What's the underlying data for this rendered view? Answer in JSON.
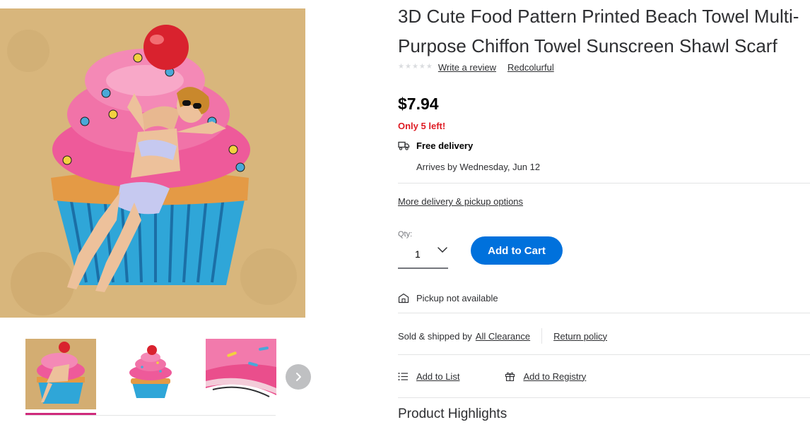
{
  "product": {
    "title_line1": "3D Cute Food Pattern Printed Beach Towel Multi-",
    "title_line2": "Purpose Chiffon Towel Sunscreen Shawl Scarf",
    "rating_icon": "star-rating-empty",
    "write_review": "Write a review",
    "brand": "Redcolurful",
    "image_alt": "Cupcake shaped beach towel with woman lying on sand"
  },
  "pricing": {
    "price": "$7.94",
    "stock_note": "Only 5 left!"
  },
  "delivery": {
    "icon": "truck-icon",
    "label": "Free delivery",
    "arrives": "Arrives by Wednesday, Jun 12",
    "more_options": "More delivery & pickup options"
  },
  "purchase": {
    "qty_label": "Qty:",
    "qty_value": "1",
    "add_to_cart": "Add to Cart"
  },
  "pickup": {
    "icon": "store-icon",
    "label": "Pickup not available"
  },
  "seller": {
    "sold_label": "Sold & shipped by",
    "seller_name": "All Clearance",
    "return_policy": "Return policy"
  },
  "actions": {
    "add_to_list": "Add to List",
    "add_to_registry": "Add to Registry"
  },
  "sections": {
    "highlights": "Product Highlights"
  },
  "colors": {
    "primary_button": "#0071dc",
    "stock_red": "#de1c24",
    "thumb_selected": "#cf2a7b",
    "text": "#2e2f32"
  }
}
